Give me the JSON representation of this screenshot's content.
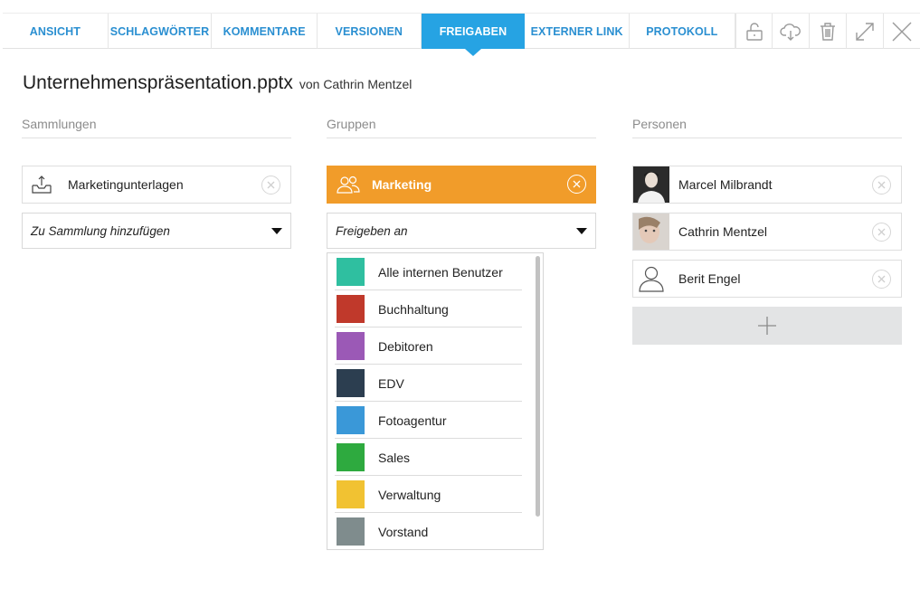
{
  "tabs": [
    {
      "label": "ANSICHT",
      "active": false
    },
    {
      "label": "SCHLAGWÖRTER",
      "active": false
    },
    {
      "label": "KOMMENTARE",
      "active": false
    },
    {
      "label": "VERSIONEN",
      "active": false
    },
    {
      "label": "FREIGABEN",
      "active": true
    },
    {
      "label": "EXTERNER LINK",
      "active": false
    },
    {
      "label": "PROTOKOLL",
      "active": false
    }
  ],
  "toolbar_icons": [
    "unlock-icon",
    "cloud-download-icon",
    "trash-icon",
    "expand-icon",
    "close-icon"
  ],
  "file": {
    "name": "Unternehmenspräsentation.pptx",
    "byline": "von Cathrin Mentzel"
  },
  "collections": {
    "heading": "Sammlungen",
    "item": "Marketingunterlagen",
    "select_placeholder": "Zu Sammlung hinzufügen"
  },
  "groups": {
    "heading": "Gruppen",
    "selected": "Marketing",
    "selected_color": "#f19c2a",
    "select_placeholder": "Freigeben an",
    "options": [
      {
        "label": "Alle internen Benutzer",
        "color": "#2fbfa0"
      },
      {
        "label": "Buchhaltung",
        "color": "#c0392b"
      },
      {
        "label": "Debitoren",
        "color": "#9b59b6"
      },
      {
        "label": "EDV",
        "color": "#2c3e50"
      },
      {
        "label": "Fotoagentur",
        "color": "#3a98d8"
      },
      {
        "label": "Sales",
        "color": "#2eaa3f"
      },
      {
        "label": "Verwaltung",
        "color": "#f1c232"
      },
      {
        "label": "Vorstand",
        "color": "#7f8c8d"
      }
    ]
  },
  "persons": {
    "heading": "Personen",
    "items": [
      {
        "name": "Marcel Milbrandt",
        "avatar": "photo"
      },
      {
        "name": "Cathrin Mentzel",
        "avatar": "photo"
      },
      {
        "name": "Berit Engel",
        "avatar": "placeholder-user-icon"
      }
    ]
  }
}
